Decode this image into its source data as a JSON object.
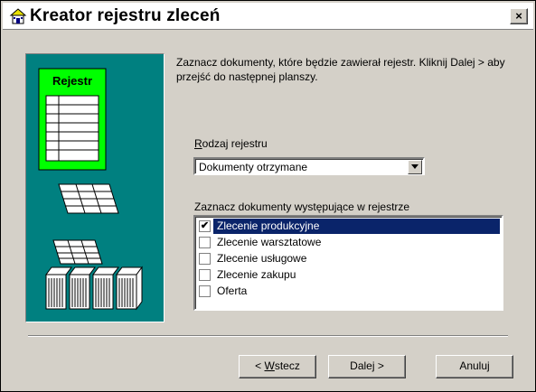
{
  "window": {
    "title": "Kreator rejestru zleceń",
    "close_glyph": "×"
  },
  "illustration": {
    "label": "Rejestr",
    "bg_color": "#008080",
    "highlight_color": "#00ff00"
  },
  "description": "Zaznacz dokumenty, które będzie zawierał rejestr. Kliknij Dalej > aby przejść do następnej planszy.",
  "register_type": {
    "label": "Rodzaj rejestru",
    "selected": "Dokumenty otrzymane"
  },
  "documents": {
    "label": "Zaznacz dokumenty występujące w rejestrze",
    "items": [
      {
        "label": "Zlecenie produkcyjne",
        "checked": true,
        "selected": true
      },
      {
        "label": "Zlecenie warsztatowe",
        "checked": false,
        "selected": false
      },
      {
        "label": "Zlecenie usługowe",
        "checked": false,
        "selected": false
      },
      {
        "label": "Zlecenie zakupu",
        "checked": false,
        "selected": false
      },
      {
        "label": "Oferta",
        "checked": false,
        "selected": false
      }
    ]
  },
  "buttons": {
    "back": "< Wstecz",
    "next": "Dalej >",
    "cancel": "Anuluj"
  },
  "colors": {
    "selection": "#0a246a",
    "dialog_face": "#d4d0c8"
  }
}
